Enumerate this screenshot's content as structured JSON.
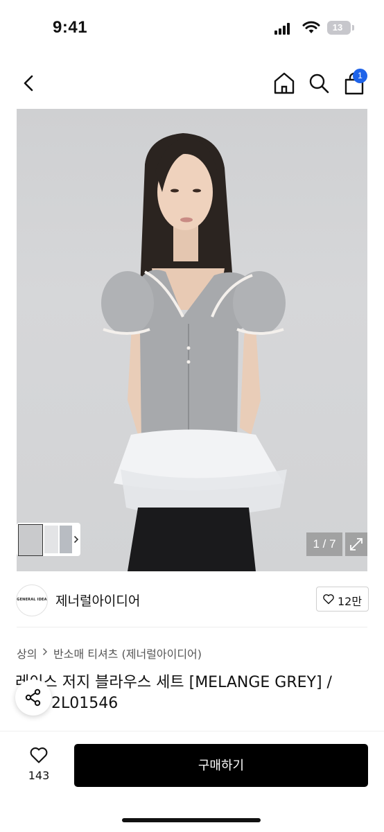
{
  "status_bar": {
    "time": "9:41",
    "battery": "13"
  },
  "header": {
    "cart_count": "1"
  },
  "gallery": {
    "counter": "1 / 7"
  },
  "brand": {
    "logo_text": "GENERAL IDEA",
    "name": "제너럴아이디어",
    "likes": "12만"
  },
  "breadcrumb": [
    "상의",
    "반소매 티셔츠 (제너럴아이디어)"
  ],
  "product": {
    "title_line1": "레이스 저지 블라우스 세트 [MELANGE GREY] /",
    "title_line2": "2L01546"
  },
  "bottom_bar": {
    "wish_count": "143",
    "buy_label": "구매하기"
  },
  "colors": {
    "accent": "#1e63e9",
    "buy_button": "#000000"
  },
  "icons": [
    "back-icon",
    "home-icon",
    "search-icon",
    "cart-icon",
    "expand-icon",
    "heart-icon",
    "share-icon",
    "chevron-right-icon"
  ]
}
